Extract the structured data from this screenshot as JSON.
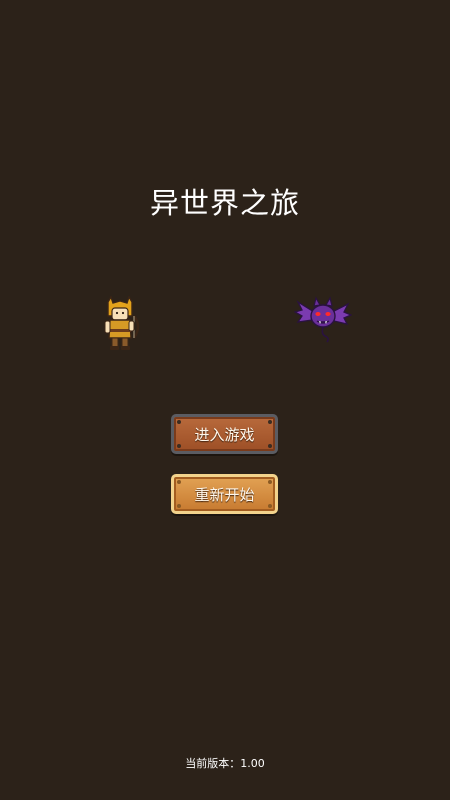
{
  "title": "异世界之旅",
  "buttons": {
    "enter_game": "进入游戏",
    "restart": "重新开始"
  },
  "version": {
    "label": "当前版本：",
    "value": "1.00"
  },
  "sprites": {
    "hero": "hero-warrior-sprite",
    "enemy": "purple-bat-sprite"
  },
  "colors": {
    "background": "#2c2219",
    "enter_button": "#a9582c",
    "restart_button": "#d58b3f",
    "enemy": "#6a2f9a"
  }
}
